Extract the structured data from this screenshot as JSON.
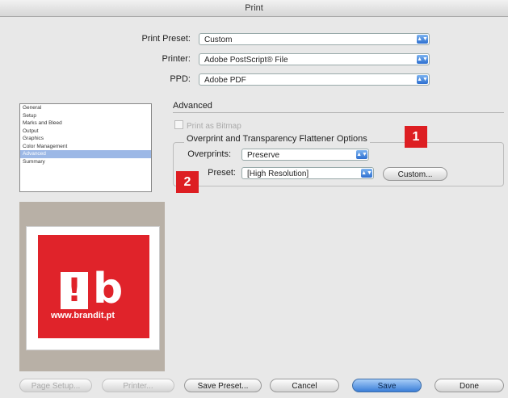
{
  "window": {
    "title": "Print"
  },
  "top_fields": [
    {
      "label": "Print Preset:",
      "value": "Custom"
    },
    {
      "label": "Printer:",
      "value": "Adobe PostScript® File"
    },
    {
      "label": "PPD:",
      "value": "Adobe PDF"
    }
  ],
  "sidebar": {
    "items": [
      {
        "label": "General"
      },
      {
        "label": "Setup"
      },
      {
        "label": "Marks and Bleed"
      },
      {
        "label": "Output"
      },
      {
        "label": "Graphics"
      },
      {
        "label": "Color Management"
      },
      {
        "label": "Advanced",
        "selected": true
      },
      {
        "label": "Summary"
      }
    ]
  },
  "advanced": {
    "title": "Advanced",
    "print_as_bitmap": "Print as Bitmap",
    "group_title": "Overprint and Transparency Flattener Options",
    "overprints_label": "Overprints:",
    "overprints_value": "Preserve",
    "preset_label": "Preset:",
    "preset_value": "[High Resolution]",
    "custom_button": "Custom..."
  },
  "markers": [
    "1",
    "2"
  ],
  "preview": {
    "logo_text": "!",
    "logo_letter": "b",
    "url": "www.brandit.pt",
    "brand_color": "#e0232a"
  },
  "buttons": {
    "page_setup": "Page Setup...",
    "printer": "Printer...",
    "save_preset": "Save Preset...",
    "cancel": "Cancel",
    "save": "Save",
    "done": "Done"
  }
}
